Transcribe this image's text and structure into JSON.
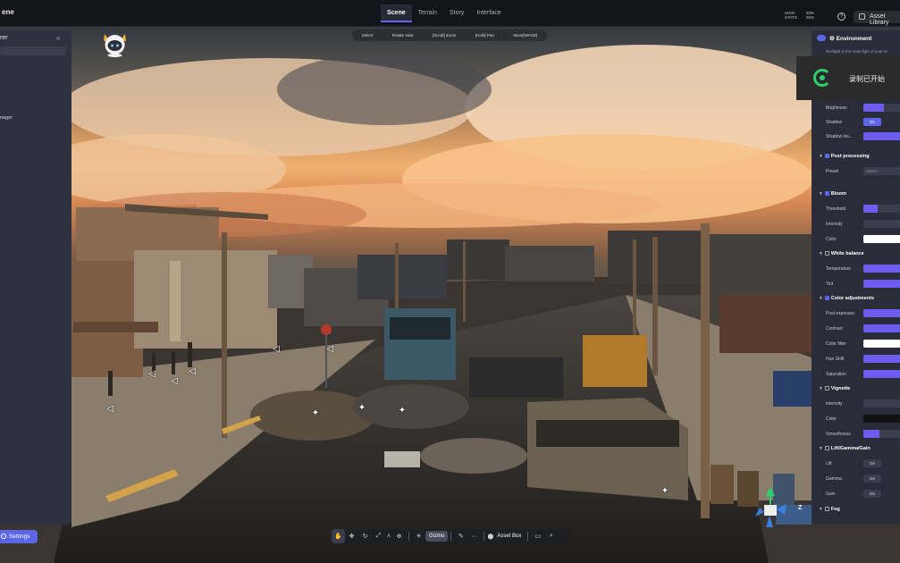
{
  "window": {
    "title": "ene"
  },
  "topbar": {
    "tabs": [
      {
        "label": "Scene",
        "active": true
      },
      {
        "label": "Terrain",
        "active": false
      },
      {
        "label": "Story",
        "active": false
      },
      {
        "label": "Interface",
        "active": false
      }
    ],
    "stats": [
      {
        "label": "HIGH",
        "value": "29%"
      },
      {
        "label": "STATS",
        "value": "26%"
      }
    ],
    "help_label": "?",
    "asset_library_label": "Asset Library"
  },
  "left_panel": {
    "header": "rer",
    "collapse_icon": "«",
    "item": "nager"
  },
  "settings_button": {
    "label": "Settings"
  },
  "hint_bar": {
    "items": [
      "Select",
      "Rotate view",
      "[Scroll] Zoom",
      "[Hold] Pan",
      "Move[WASD]"
    ]
  },
  "bottom_toolbar": {
    "gizmo_label": "Gizmo",
    "more_label": "···",
    "asset_box_label": "Asset Box"
  },
  "right_panel": {
    "environment_header": "Environment",
    "environment_desc": "Sunlight is the main light of your sc",
    "rows": {
      "brightness": "Brightness",
      "shadow": "Shadow",
      "shadow_on": "On",
      "shadow_intensity": "Shadow ins...",
      "post_processing": "Post processing",
      "preset": "Preset",
      "preset_placeholder": "Select...",
      "bloom": "Bloom",
      "threshold": "Threshold",
      "intensity": "Intensity",
      "color": "Color",
      "white_balance": "White balance",
      "temperature": "Temperature",
      "tint": "Tint",
      "color_adjustments": "Color adjustments",
      "post_exposure": "Post exposure",
      "contrast": "Contrast",
      "color_filter": "Color filter",
      "hue_shift": "Hue Shift",
      "saturation": "Saturation",
      "vignette": "Vignette",
      "v_intensity": "Intensity",
      "v_color": "Color",
      "smoothness": "Smoothness",
      "lift_gamma_gain": "Lift/Gamma/Gain",
      "lift": "Lift",
      "gamma": "Gamma",
      "gain": "Gain",
      "on": "On",
      "fog": "Fog"
    },
    "colors": {
      "accent": "#5c67e8",
      "slider": "#6d5cf0"
    }
  },
  "recording_toast": {
    "text": "录制已开始"
  },
  "gizmo": {
    "z_label": "Z"
  }
}
